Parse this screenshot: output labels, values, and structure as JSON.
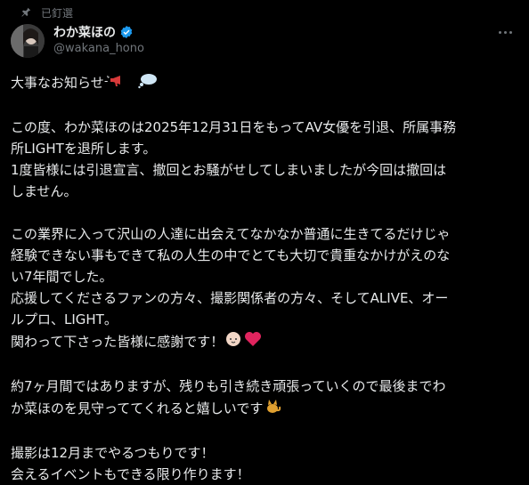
{
  "pinned": {
    "label": "已釘選"
  },
  "author": {
    "name": "わか菜ほの",
    "handle": "@wakana_hono"
  },
  "tweet": {
    "paragraphs": [
      [
        "大事なお知らせ"
      ],
      [
        "この度、わか菜ほのは2025年12月31日をもってAV女優を引退、所属事務",
        "所LIGHTを退所します。",
        "1度皆様には引退宣言、撤回とお騒がせしてしまいましたが今回は撤回は",
        "しません。"
      ],
      [
        "この業界に入って沢山の人達に出会えてなかなか普通に生きてるだけじゃ",
        "経験できない事もできて私の人生の中でとても大切で貴重なかけがえのな",
        "い7年間でした。",
        "応援してくださるファンの方々、撮影関係者の方々、そしてALIVE、オー",
        "ルプロ、LIGHT。",
        "関わって下さった皆様に感謝です！"
      ],
      [
        "約7ヶ月間ではありますが、残りも引き続き頑張っていくので最後までわ",
        "か菜ほのを見守っててくれると嬉しいです"
      ],
      [
        "撮影は12月までやるつもりです！",
        "会えるイベントもできる限り作ります！"
      ]
    ]
  },
  "icons": {
    "pin": "pin-icon",
    "verified": "verified-badge-icon",
    "more": "more-options-icon",
    "megaphone": "megaphone-emoji",
    "speech": "speech-bubble-emoji",
    "baby": "baby-emoji",
    "heart": "heart-emoji",
    "cat": "cat-emoji"
  },
  "colors": {
    "background": "#000000",
    "text": "#e7e9ea",
    "muted": "#71767b",
    "verified": "#1d9bf0"
  }
}
